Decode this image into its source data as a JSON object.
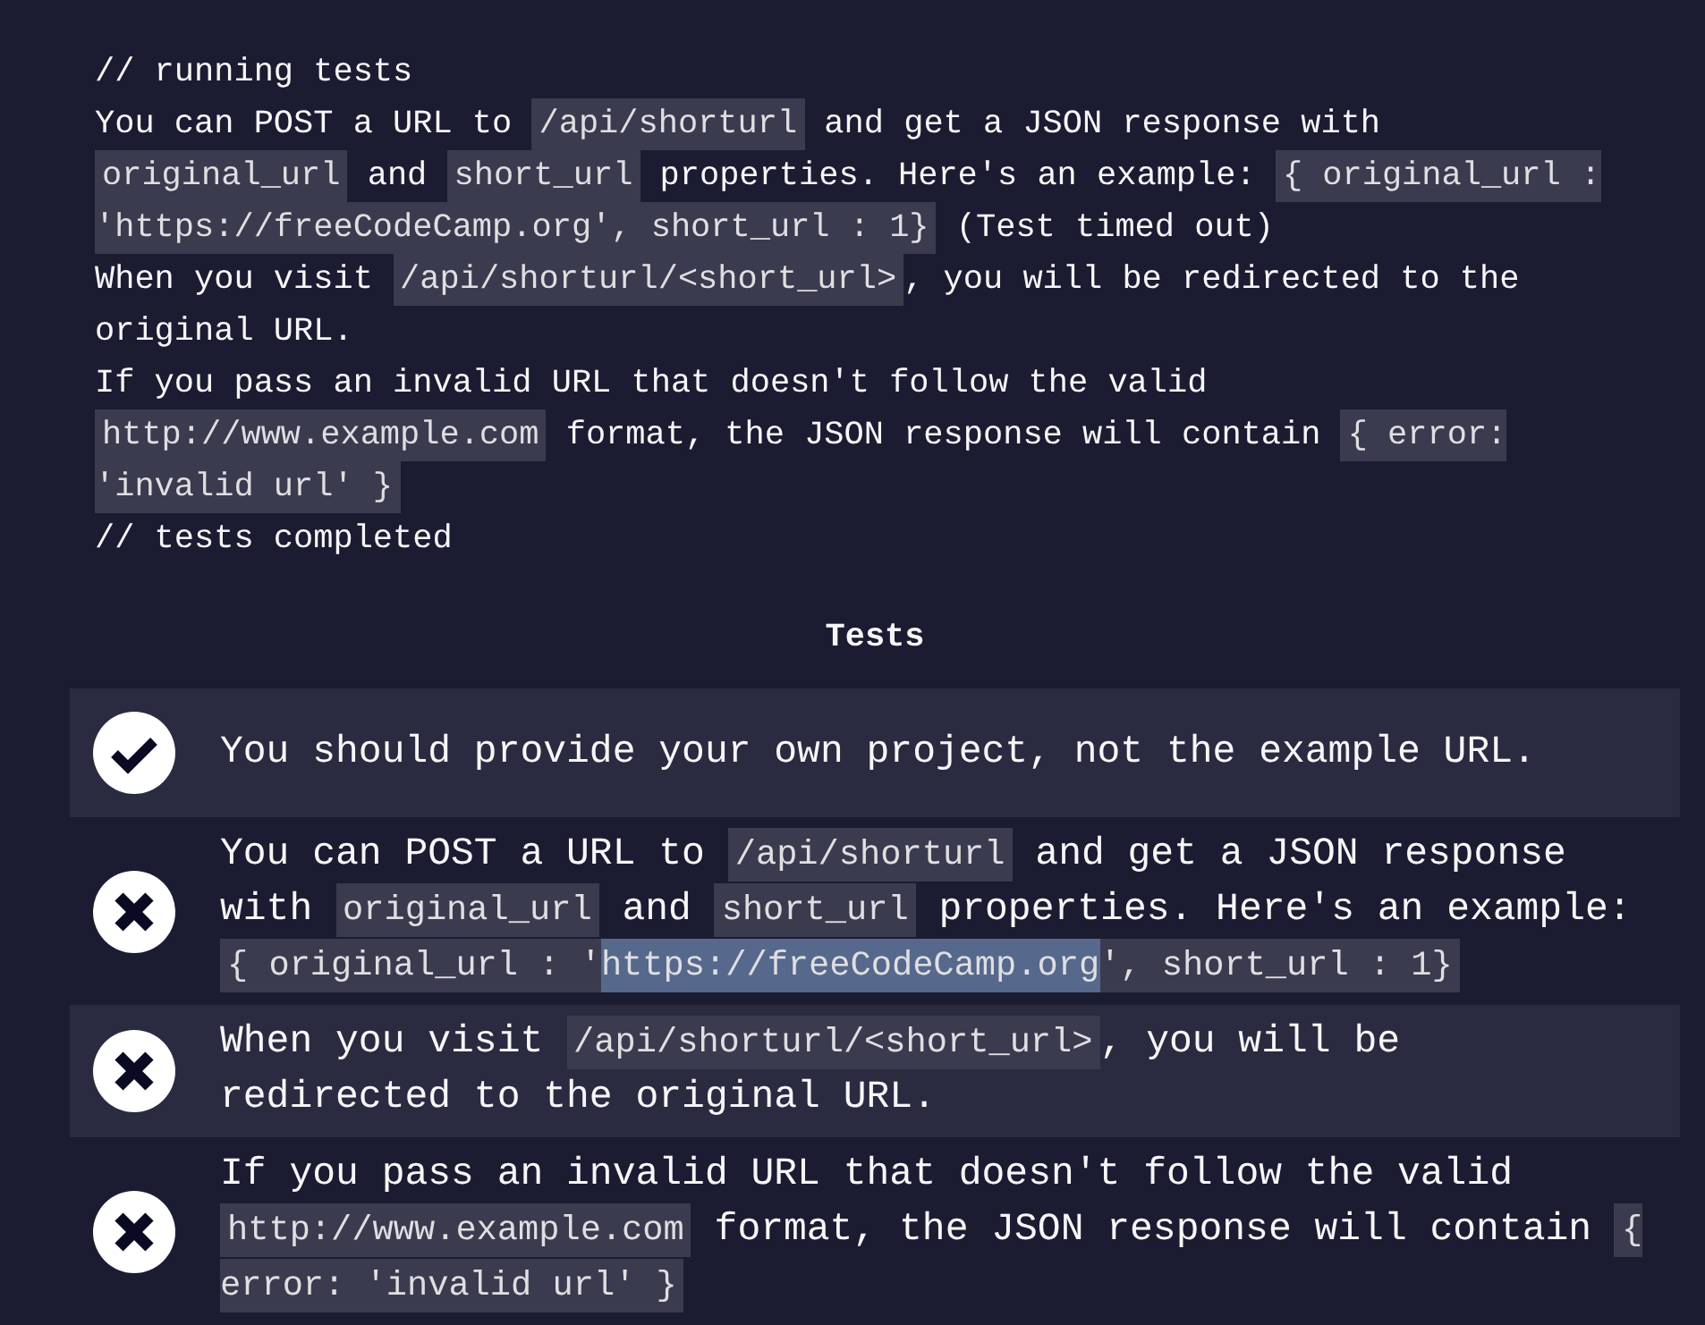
{
  "console": {
    "lines": [
      {
        "segments": [
          {
            "kind": "text",
            "text": "// running tests"
          }
        ]
      },
      {
        "segments": [
          {
            "kind": "text",
            "text": "You can POST a URL to "
          },
          {
            "kind": "code",
            "text": "/api/shorturl"
          },
          {
            "kind": "text",
            "text": " and get a JSON response with "
          },
          {
            "kind": "code",
            "text": "original_url"
          },
          {
            "kind": "text",
            "text": " and "
          },
          {
            "kind": "code",
            "text": "short_url"
          },
          {
            "kind": "text",
            "text": " properties. Here's an example: "
          },
          {
            "kind": "code",
            "text": "{ original_url : 'https://freeCodeCamp.org', short_url : 1}"
          },
          {
            "kind": "text",
            "text": " (Test timed out)"
          }
        ]
      },
      {
        "segments": [
          {
            "kind": "text",
            "text": "When you visit "
          },
          {
            "kind": "code",
            "text": "/api/shorturl/<short_url>"
          },
          {
            "kind": "text",
            "text": ", you will be redirected to the original URL."
          }
        ]
      },
      {
        "segments": [
          {
            "kind": "text",
            "text": "If you pass an invalid URL that doesn't follow the valid "
          },
          {
            "kind": "code",
            "text": "http://www.example.com"
          },
          {
            "kind": "text",
            "text": " format, the JSON response will contain "
          },
          {
            "kind": "code",
            "text": "{ error: 'invalid url' }"
          }
        ]
      },
      {
        "segments": [
          {
            "kind": "text",
            "text": "// tests completed"
          }
        ]
      }
    ]
  },
  "tests_heading": "Tests",
  "tests": [
    {
      "passed": true,
      "segments": [
        {
          "kind": "text",
          "text": "You should provide your own project, not the example URL."
        }
      ]
    },
    {
      "passed": false,
      "segments": [
        {
          "kind": "text",
          "text": "You can POST a URL to "
        },
        {
          "kind": "code",
          "text": "/api/shorturl"
        },
        {
          "kind": "text",
          "text": " and get a JSON response with "
        },
        {
          "kind": "code",
          "text": "original_url"
        },
        {
          "kind": "text",
          "text": " and "
        },
        {
          "kind": "code",
          "text": "short_url"
        },
        {
          "kind": "text",
          "text": " properties. Here's an example: "
        },
        {
          "kind": "code",
          "parts": [
            {
              "text": "{ original_url : '",
              "highlighted": false
            },
            {
              "text": "https://freeCodeCamp.org",
              "highlighted": true
            },
            {
              "text": "', short_url : 1}",
              "highlighted": false
            }
          ]
        }
      ]
    },
    {
      "passed": false,
      "segments": [
        {
          "kind": "text",
          "text": "When you visit "
        },
        {
          "kind": "code",
          "text": "/api/shorturl/<short_url>"
        },
        {
          "kind": "text",
          "text": ", you will be redirected to the original URL."
        }
      ]
    },
    {
      "passed": false,
      "segments": [
        {
          "kind": "text",
          "text": "If you pass an invalid URL that doesn't follow the valid "
        },
        {
          "kind": "code",
          "text": "http://www.example.com"
        },
        {
          "kind": "text",
          "text": " format, the JSON response will contain "
        },
        {
          "kind": "code",
          "text": "{ error: 'invalid url' }"
        }
      ]
    }
  ]
}
